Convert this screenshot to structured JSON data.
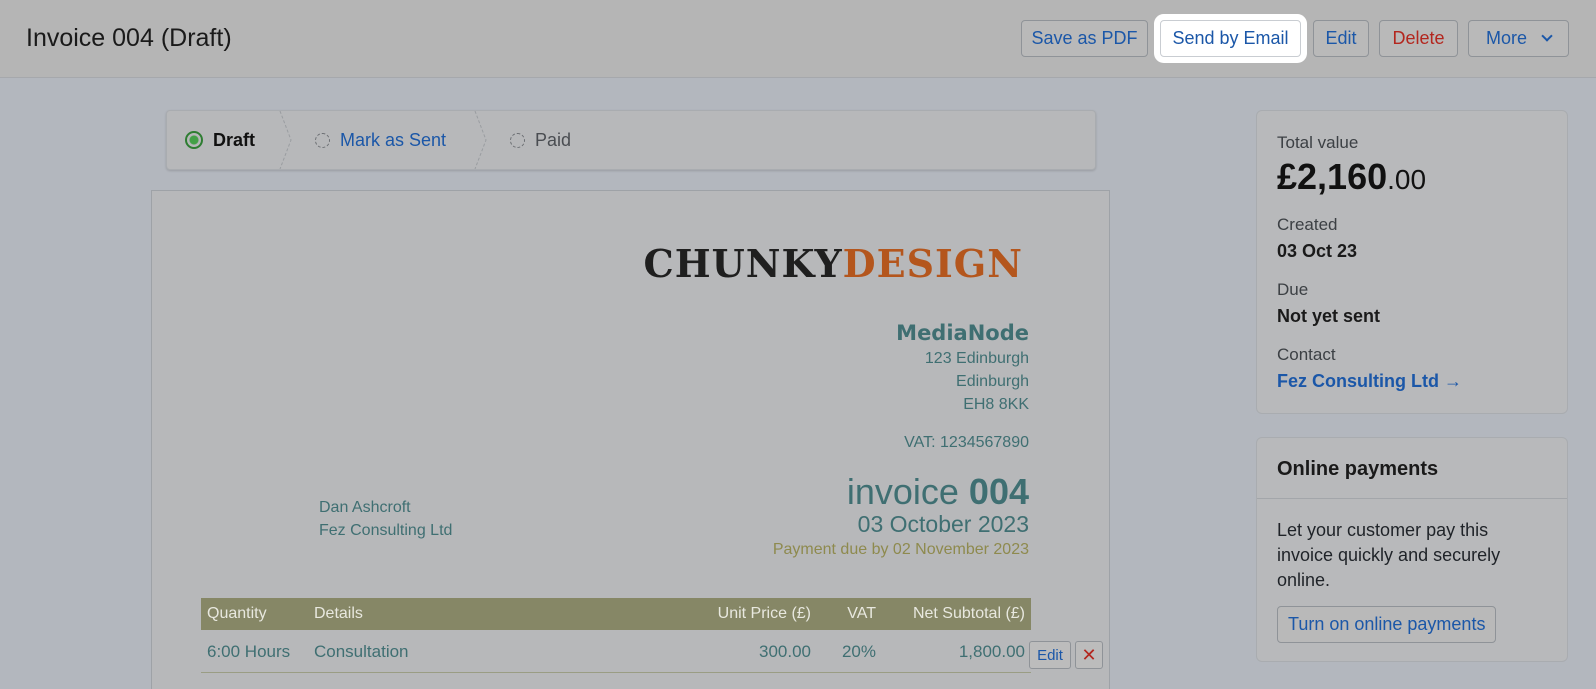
{
  "header": {
    "title": "Invoice 004 (Draft)",
    "buttons": {
      "save_pdf": "Save as PDF",
      "send_email": "Send by Email",
      "edit": "Edit",
      "delete": "Delete",
      "more": "More"
    }
  },
  "stepper": {
    "steps": [
      {
        "label": "Draft",
        "state": "active"
      },
      {
        "label": "Mark as Sent",
        "state": "link"
      },
      {
        "label": "Paid",
        "state": "pending"
      }
    ]
  },
  "invoice": {
    "logo": {
      "part1": "CHUNKY",
      "part2": "DESIGN"
    },
    "company": "MediaNode",
    "address": [
      "123 Edinburgh",
      "Edinburgh",
      "EH8 8KK"
    ],
    "vat": "VAT: 1234567890",
    "client": [
      "Dan Ashcroft",
      "Fez Consulting Ltd"
    ],
    "title_word": "invoice",
    "number": "004",
    "date": "03 October 2023",
    "due": "Payment due by 02 November 2023",
    "columns": [
      "Quantity",
      "Details",
      "Unit Price (£)",
      "VAT",
      "Net Subtotal (£)"
    ],
    "rows": [
      {
        "quantity": "6:00 Hours",
        "details": "Consultation",
        "unit_price": "300.00",
        "vat": "20%",
        "subtotal": "1,800.00"
      }
    ],
    "row_edit_label": "Edit",
    "row_delete_label": "✕"
  },
  "summary": {
    "total_label": "Total value",
    "total_main": "£2,160",
    "total_cents": ".00",
    "created_label": "Created",
    "created_value": "03 Oct 23",
    "due_label": "Due",
    "due_value": "Not yet sent",
    "contact_label": "Contact",
    "contact_value": "Fez Consulting Ltd →"
  },
  "payments": {
    "title": "Online payments",
    "text": "Let your customer pay this invoice quickly and securely online.",
    "button": "Turn on online payments"
  },
  "colors": {
    "accent": "#1b57a8",
    "danger": "#b3261e",
    "logo_orange": "#b4561d",
    "invoice_teal": "#3f6f72",
    "table_header": "#868766"
  }
}
